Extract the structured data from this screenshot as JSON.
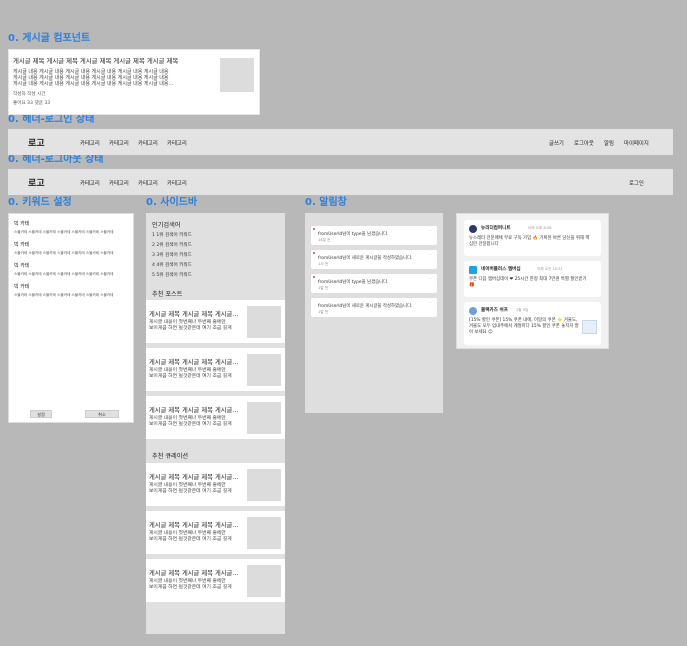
{
  "sections": {
    "post_component": "0. 게시글 컴포넌트",
    "header_logged_in": "0. 헤더-로그인 상태",
    "header_logged_out": "0. 헤더-로그아웃 상태",
    "keyword_settings": "0. 키워드 설정",
    "sidebar": "0. 사이드바",
    "notifications": "0. 알림창"
  },
  "post": {
    "title": "게시글 제목 게시글 제목 게시글 제목 게시글 제목 게시글 제목",
    "body": [
      "게시글 내용 게시글 내용 게시글 내용 게시글 내용 게시글 내용 게시글 내용",
      "게시글 내용 게시글 내용 게시글 내용 게시글 내용 게시글 내용 게시글 내용",
      "게시글 내용 게시글 내용 게시글 내용 게시글 내용 게시글 내용 게시글 내용..."
    ],
    "author": "작성자 작성 시간",
    "stats": "좋아요 33 댓글 33"
  },
  "header_in": {
    "logo": "로고",
    "nav": [
      "카테고리",
      "카테고리",
      "카테고리",
      "카테고리"
    ],
    "links": [
      "글쓰기",
      "로그아웃",
      "알림",
      "마이페이지"
    ]
  },
  "header_out": {
    "logo": "로고",
    "nav": [
      "카테고리",
      "카테고리",
      "카테고리",
      "카테고리"
    ],
    "login": "로그인"
  },
  "keywords": {
    "groups": [
      {
        "cat": "빅 카테",
        "sub": "스몰카테 스몰카테 스몰카테 스몰카테 스몰카테 스몰카테 스몰카테"
      },
      {
        "cat": "빅 카테",
        "sub": "스몰카테 스몰카테 스몰카테 스몰카테 스몰카테 스몰카테 스몰카테"
      },
      {
        "cat": "빅 카테",
        "sub": "스몰카테 스몰카테 스몰카테 스몰카테 스몰카테 스몰카테 스몰카테"
      },
      {
        "cat": "빅 카테",
        "sub": "스몰카테 스몰카테 스몰카테 스몰카테 스몰카테 스몰카테 스몰카테"
      }
    ],
    "btn_save": "설정",
    "btn_cancel": "취소"
  },
  "sidebar": {
    "popular_heading": "인기검색어",
    "ranks": [
      "1  1위 검색어 키워드",
      "2  2위 검색어 키워드",
      "3  3위 검색어 키워드",
      "4  4위 검색어 키워드",
      "5  5위 검색어 키워드"
    ],
    "recommend_posts_heading": "추천 포스트",
    "recommend_curation_heading": "추천 큐레이션",
    "card": {
      "title": "게시글 제목 게시글 제목 게시글...",
      "body1": "게시글 내용이 첫번째나 두번째 줄에만",
      "body2": "보이게끔 하면 될것같은데 여기 조금 길게"
    }
  },
  "notifications": {
    "items": [
      {
        "text": "fromUserId님이 type을 남겼습니다.",
        "time": "14분 전"
      },
      {
        "text": "fromUserId님이 새로운 게시글을 작성하였습니다.",
        "time": "1시 전"
      },
      {
        "text": "fromUserId님이 type을 남겼습니다.",
        "time": "1일 전"
      },
      {
        "text": "fromUserId님이 새로운 게시글을 작성하였습니다.",
        "time": "1일 전"
      }
    ],
    "more": "..."
  },
  "sample": {
    "items": [
      {
        "name": "뉴리더컴퍼니트",
        "sub": "어제 오후 8:08",
        "body": "뉴스레터 전문매체 무료 구독 가입 🔥 기획된 바른 당신을 위해 핵심만 전달합니다",
        "avatar": "#2a3a6a"
      },
      {
        "name": "네이버플러스 멤버십",
        "sub": "어제 오전 10:51",
        "body": "쿠폰 다음 멤버십데이 ❤ 25시간 한정 최대 7만원 특별 할인받기 🎁",
        "avatar": "#1fa2e6"
      },
      {
        "name": "블랙카즈 쉬프",
        "sub": "1월 9일",
        "body": "[15% 할인 쿠폰] 15% 쿠폰 내에, 이달의 쿠폰 ⭐ 겨울도, 겨울도 모두 입내주에서 계절마다 15% 할인 쿠폰 놓치지 말아 보세요 😊",
        "avatar": "#6f9fd8"
      }
    ]
  }
}
